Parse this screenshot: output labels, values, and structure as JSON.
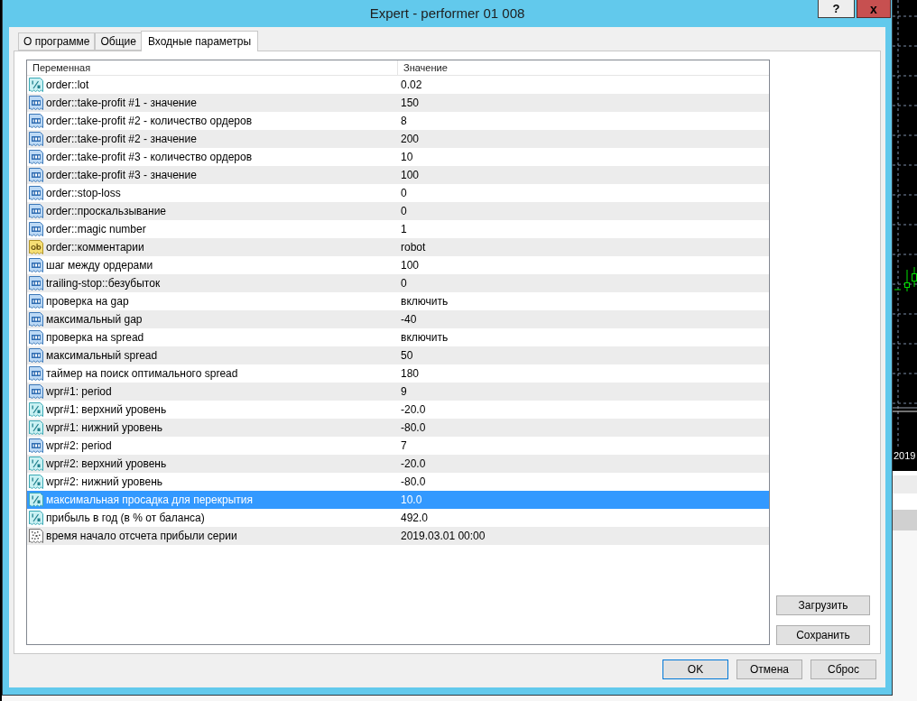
{
  "window": {
    "title": "Expert - performer 01 008",
    "help_button": "?",
    "close_button": "x"
  },
  "tabs": [
    {
      "label": "О программе",
      "selected": false
    },
    {
      "label": "Общие",
      "selected": false
    },
    {
      "label": "Входные параметры",
      "selected": true
    }
  ],
  "table": {
    "columns": [
      "Переменная",
      "Значение"
    ],
    "rows": [
      {
        "kind": "double",
        "name": "order::lot",
        "value": "0.02",
        "selected": false
      },
      {
        "kind": "integer",
        "name": "order::take-profit #1 - значение",
        "value": "150",
        "selected": false
      },
      {
        "kind": "integer",
        "name": "order::take-profit #2 - количество ордеров",
        "value": "8",
        "selected": false
      },
      {
        "kind": "integer",
        "name": "order::take-profit #2 - значение",
        "value": "200",
        "selected": false
      },
      {
        "kind": "integer",
        "name": "order::take-profit #3 - количество ордеров",
        "value": "10",
        "selected": false
      },
      {
        "kind": "integer",
        "name": "order::take-profit #3 - значение",
        "value": "100",
        "selected": false
      },
      {
        "kind": "integer",
        "name": "order::stop-loss",
        "value": "0",
        "selected": false
      },
      {
        "kind": "integer",
        "name": "order::проскальзывание",
        "value": "0",
        "selected": false
      },
      {
        "kind": "integer",
        "name": "order::magic number",
        "value": "1",
        "selected": false
      },
      {
        "kind": "string",
        "name": "order::комментарии",
        "value": "robot",
        "selected": false
      },
      {
        "kind": "integer",
        "name": "шаг между ордерами",
        "value": "100",
        "selected": false
      },
      {
        "kind": "integer",
        "name": "trailing-stop::безубыток",
        "value": "0",
        "selected": false
      },
      {
        "kind": "integer",
        "name": "проверка на gap",
        "value": "включить",
        "selected": false
      },
      {
        "kind": "integer",
        "name": "максимальный gap",
        "value": "-40",
        "selected": false
      },
      {
        "kind": "integer",
        "name": "проверка на spread",
        "value": "включить",
        "selected": false
      },
      {
        "kind": "integer",
        "name": "максимальный spread",
        "value": "50",
        "selected": false
      },
      {
        "kind": "integer",
        "name": "таймер на поиск оптимального spread",
        "value": "180",
        "selected": false
      },
      {
        "kind": "integer",
        "name": "wpr#1: period",
        "value": "9",
        "selected": false
      },
      {
        "kind": "double",
        "name": "wpr#1: верхний уровень",
        "value": "-20.0",
        "selected": false
      },
      {
        "kind": "double",
        "name": "wpr#1: нижний уровень",
        "value": "-80.0",
        "selected": false
      },
      {
        "kind": "integer",
        "name": "wpr#2: period",
        "value": "7",
        "selected": false
      },
      {
        "kind": "double",
        "name": "wpr#2: верхний уровень",
        "value": "-20.0",
        "selected": false
      },
      {
        "kind": "double",
        "name": "wpr#2: нижний уровень",
        "value": "-80.0",
        "selected": false
      },
      {
        "kind": "double",
        "name": "максимальная просадка для перекрытия",
        "value": "10.0",
        "selected": true
      },
      {
        "kind": "double",
        "name": "прибыль в год (в % от баланса)",
        "value": "492.0",
        "selected": false
      },
      {
        "kind": "datetime",
        "name": "время начало отсчета прибыли серии",
        "value": "2019.03.01 00:00",
        "selected": false
      }
    ]
  },
  "side_buttons": [
    "Загрузить",
    "Сохранить"
  ],
  "buttons": [
    {
      "label": "OK",
      "focused": true
    },
    {
      "label": "Отмена",
      "focused": false
    },
    {
      "label": "Сброс",
      "focused": false
    }
  ],
  "background_chart": {
    "axis_label": "2019"
  }
}
